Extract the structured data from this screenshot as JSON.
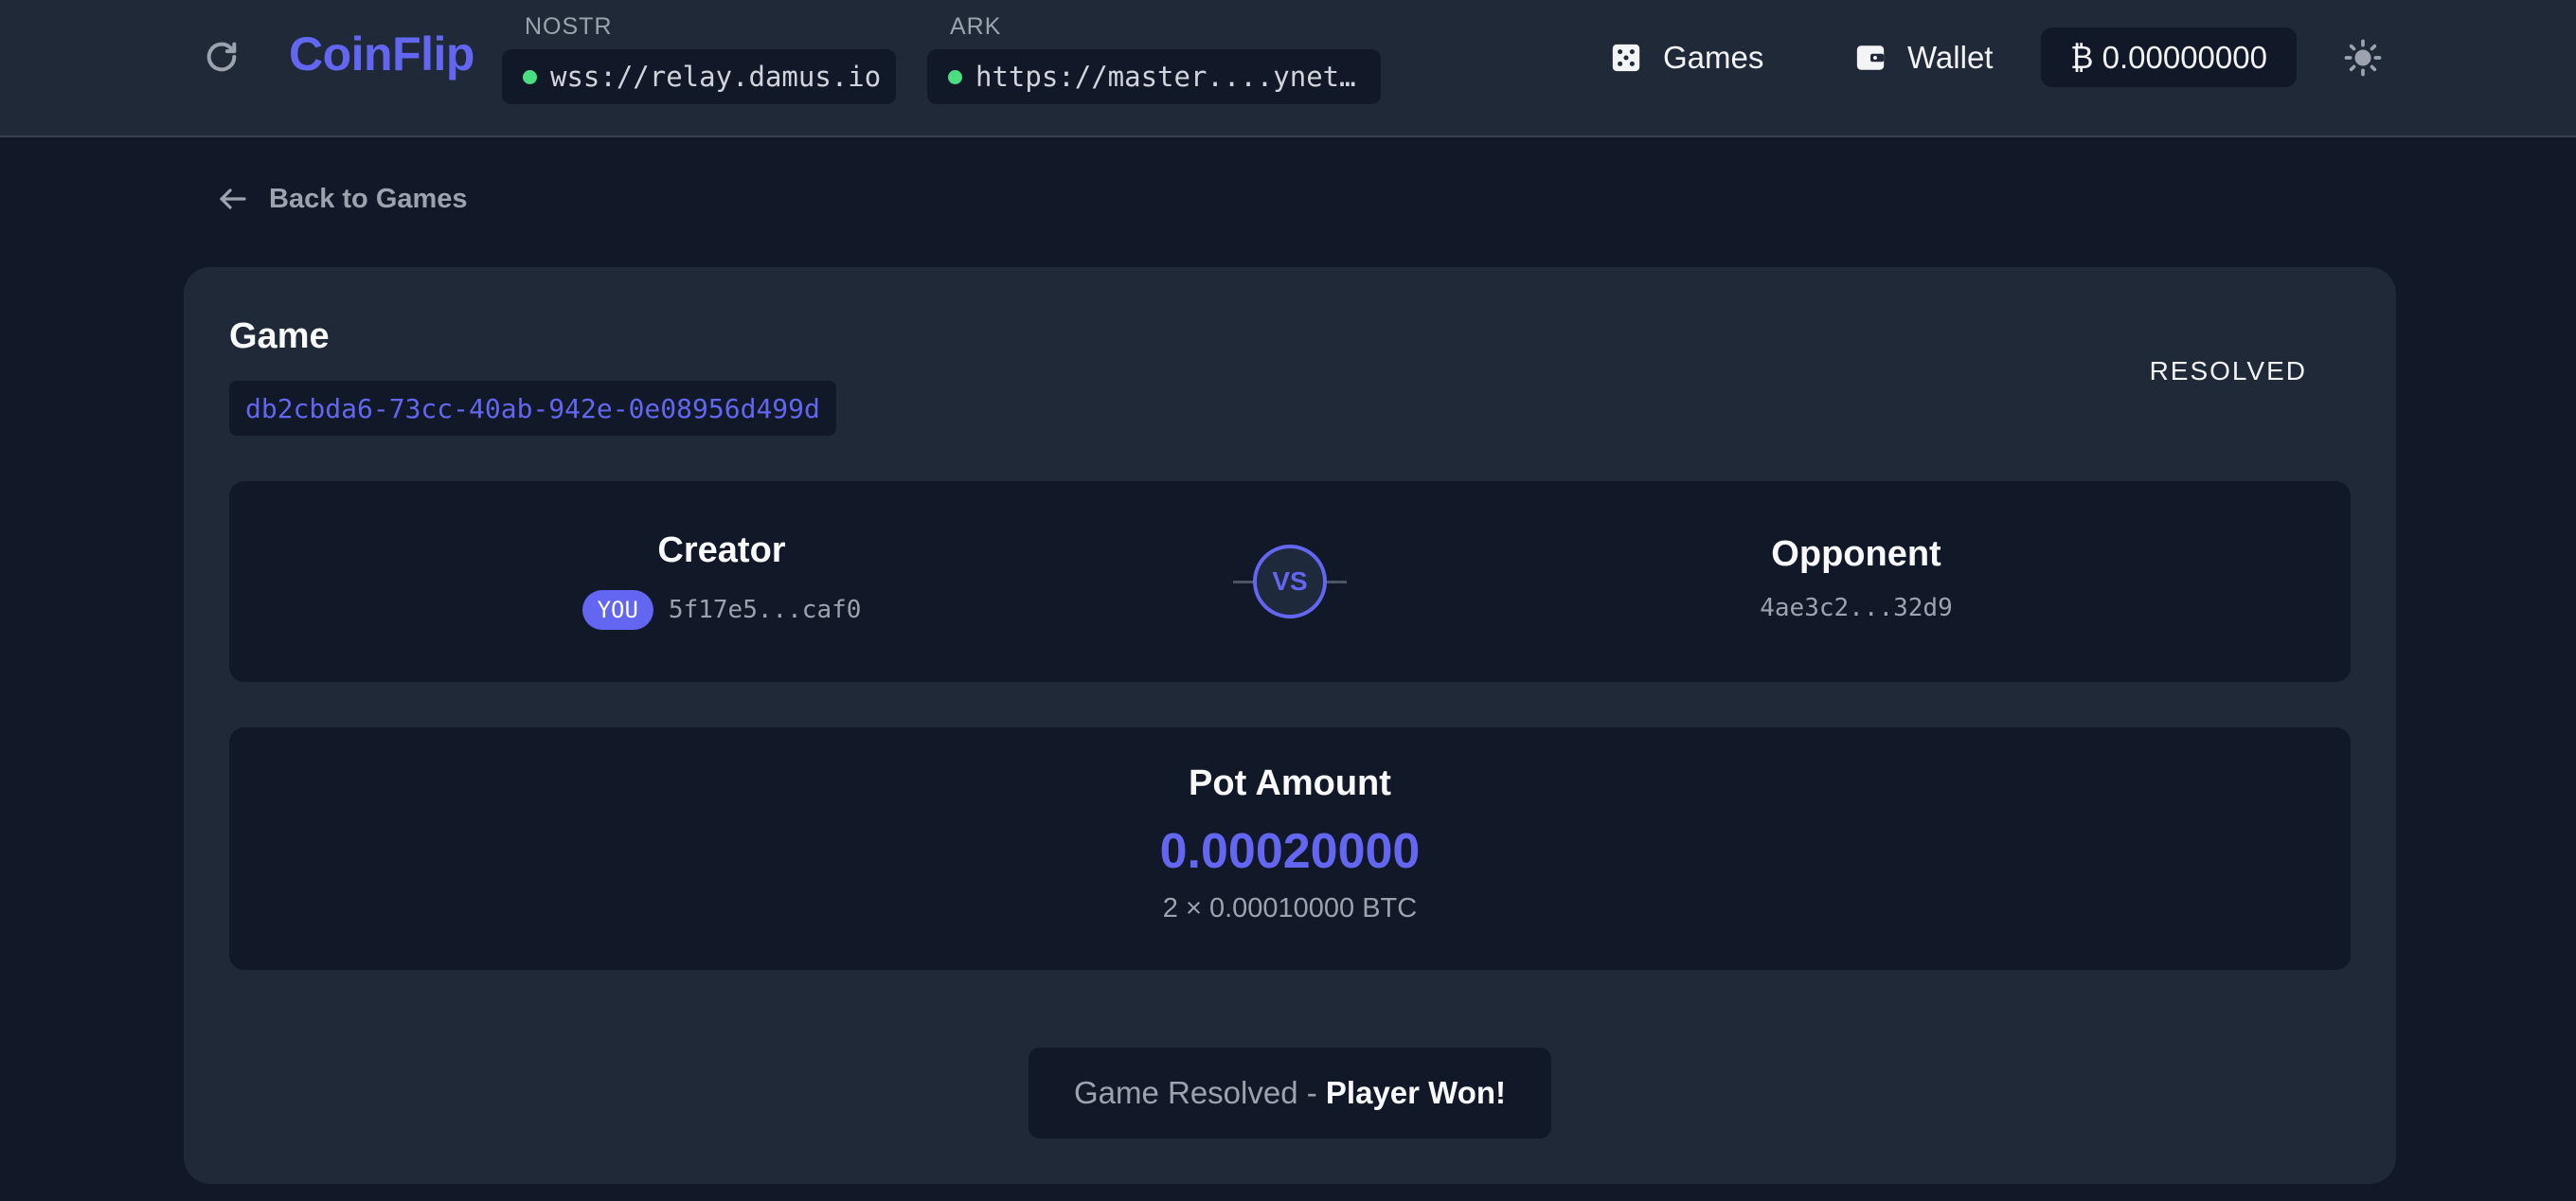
{
  "header": {
    "brand": "CoinFlip",
    "nostr": {
      "caption": "NOSTR",
      "url": "wss://relay.damus.io",
      "status_color": "#4ade80"
    },
    "ark": {
      "caption": "ARK",
      "url": "https://master....ynet…",
      "status_color": "#4ade80"
    },
    "nav": {
      "games_label": "Games",
      "wallet_label": "Wallet"
    },
    "balance": "₿ 0.00000000",
    "icons": {
      "refresh": "refresh-icon",
      "games": "dice-icon",
      "wallet": "wallet-icon",
      "theme": "sun-icon"
    }
  },
  "back_link": {
    "label": "Back to Games",
    "icon": "arrow-left-icon"
  },
  "game": {
    "title": "Game",
    "id": "db2cbda6-73cc-40ab-942e-0e08956d499d",
    "status": "RESOLVED"
  },
  "players": {
    "creator": {
      "role": "Creator",
      "badge": "YOU",
      "pubkey": "5f17e5...caf0"
    },
    "vs_label": "VS",
    "opponent": {
      "role": "Opponent",
      "pubkey": "4ae3c2...32d9"
    }
  },
  "pot": {
    "label": "Pot Amount",
    "amount": "0.00020000",
    "detail": "2 × 0.00010000 BTC"
  },
  "result": {
    "prefix": "Game Resolved - ",
    "outcome": "Player Won!"
  },
  "colors": {
    "accent": "#6366f1",
    "page_bg": "#111827",
    "panel_bg": "#1f2937",
    "connected": "#4ade80"
  }
}
